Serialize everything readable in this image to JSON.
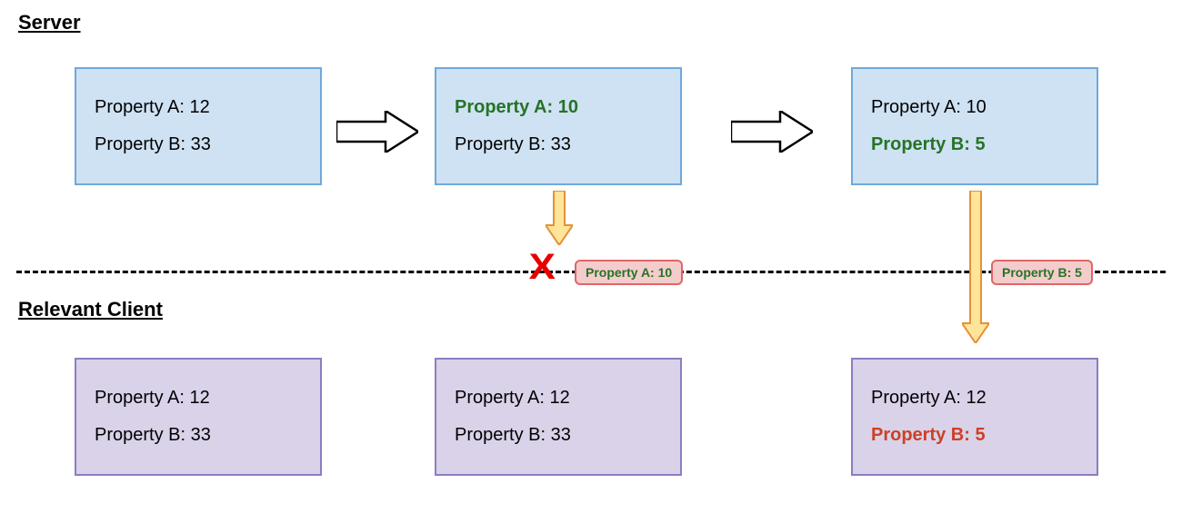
{
  "sections": {
    "server_title": "Server",
    "client_title": "Relevant Client"
  },
  "server_states": [
    {
      "propA": "Property A: 12",
      "propB": "Property B: 33",
      "highlight": "none"
    },
    {
      "propA": "Property A: 10",
      "propB": "Property B: 33",
      "highlight": "A"
    },
    {
      "propA": "Property A: 10",
      "propB": "Property B: 5",
      "highlight": "B"
    }
  ],
  "client_states": [
    {
      "propA": "Property A: 12",
      "propB": "Property B: 33",
      "highlight": "none"
    },
    {
      "propA": "Property A: 12",
      "propB": "Property B: 33",
      "highlight": "none"
    },
    {
      "propA": "Property A: 12",
      "propB": "Property B: 5",
      "highlight": "B_error"
    }
  ],
  "messages": {
    "blocked": "Property A: 10",
    "delivered": "Property B: 5"
  },
  "icons": {
    "blocked_mark": "X"
  }
}
